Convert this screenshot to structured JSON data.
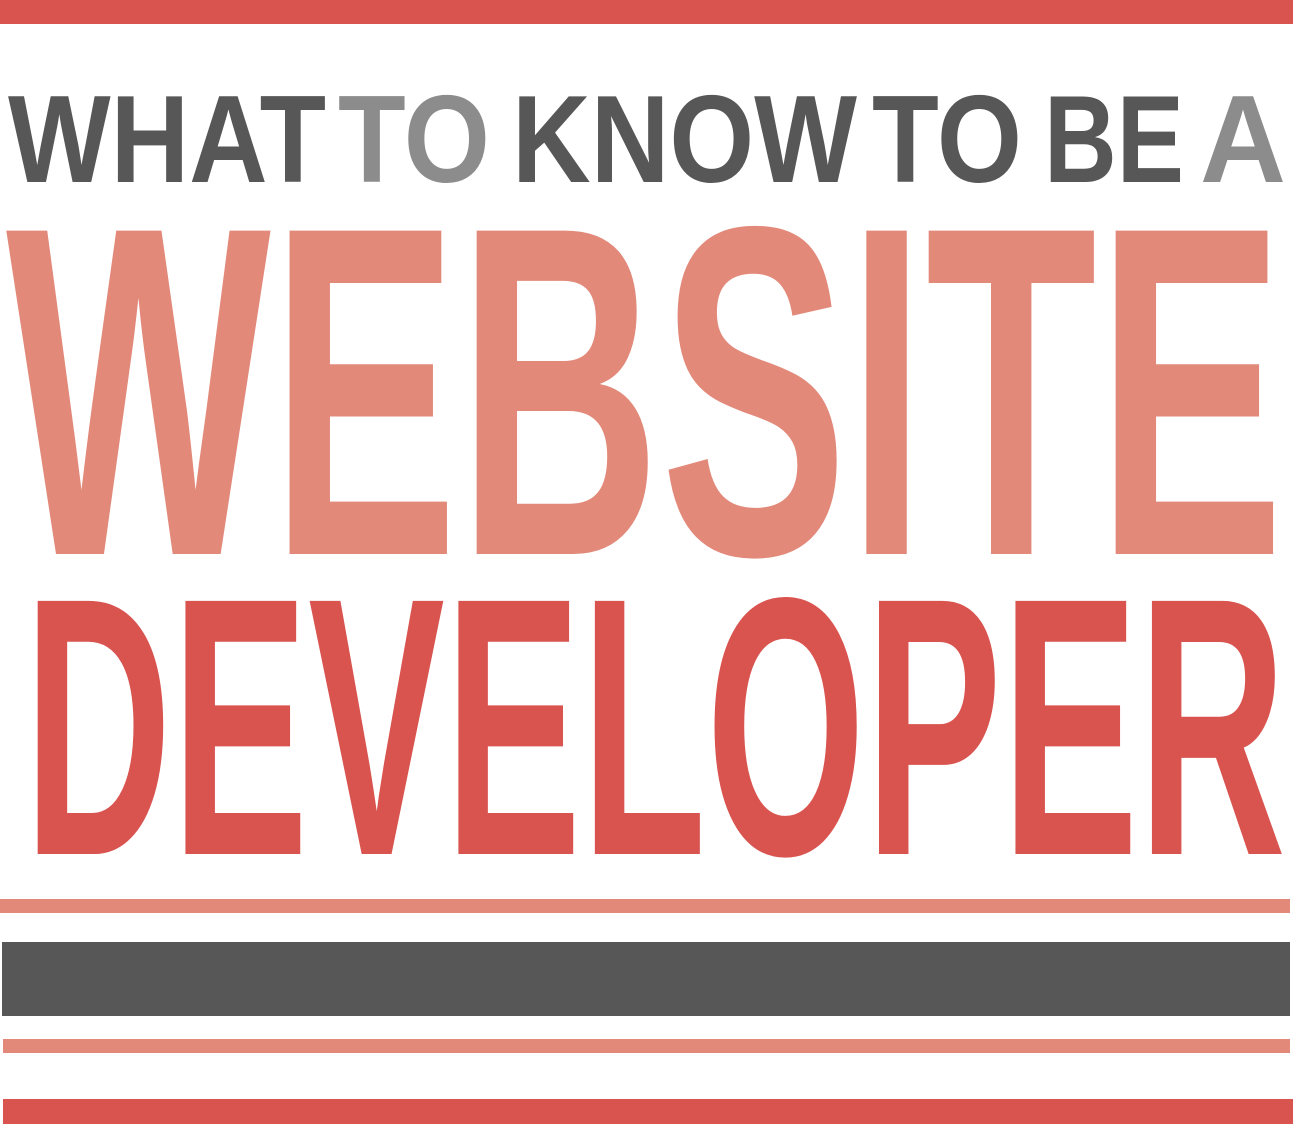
{
  "headline": {
    "top_line": {
      "words": [
        {
          "text": "WHAT",
          "color": "#575757"
        },
        {
          "text": "TO",
          "color": "#8c8c8c"
        },
        {
          "text": "KNOW",
          "color": "#575757"
        },
        {
          "text": "TO",
          "color": "#575757"
        },
        {
          "text": "BE",
          "color": "#575757"
        },
        {
          "text": "A",
          "color": "#8c8c8c"
        }
      ]
    },
    "middle_line": {
      "text": "WEBSITE",
      "color": "#e2897a"
    },
    "bottom_line": {
      "text": "DEVELOPER",
      "color": "#d9534f"
    }
  },
  "colors": {
    "red": "#d9534f",
    "salmon": "#e2897a",
    "dark_gray": "#575757",
    "light_gray": "#8c8c8c",
    "background": "#ffffff"
  }
}
